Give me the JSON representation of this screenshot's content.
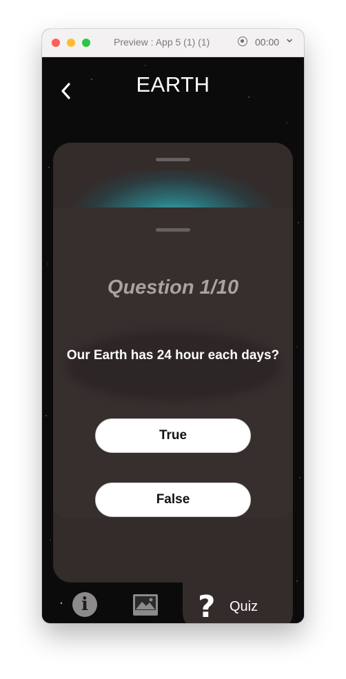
{
  "window": {
    "title": "Preview : App 5 (1) (1)",
    "timer": "00:00"
  },
  "header": {
    "title": "EARTH",
    "back_icon": "chevron-left-icon"
  },
  "quiz": {
    "question_number": "Question 1/10",
    "question_text": "Our Earth has 24 hour each days?",
    "answers": [
      {
        "label": "True"
      },
      {
        "label": "False"
      }
    ]
  },
  "tabbar": {
    "items": [
      {
        "icon": "info-icon",
        "glyph": "i"
      },
      {
        "icon": "image-icon"
      },
      {
        "icon": "question-icon",
        "glyph": "?",
        "label": "Quiz",
        "selected": true
      }
    ]
  },
  "colors": {
    "background": "#0b0b0b",
    "panel": "#342b2b",
    "glow": "#46d2d2",
    "button": "#ffffff"
  }
}
